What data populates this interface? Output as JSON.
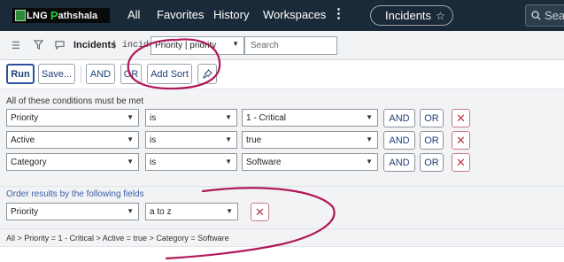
{
  "logo": {
    "lng": "LNG",
    "p": "P",
    "rest": "athshala"
  },
  "topnav": {
    "links": [
      "All",
      "Favorites",
      "History",
      "Workspaces"
    ],
    "current_tab": "Incidents",
    "search_placeholder": "Sear"
  },
  "listbar": {
    "title": "Incidents",
    "table_name": "incident",
    "field_select": "Priority | priority",
    "search_placeholder": "Search"
  },
  "buttons": {
    "run": "Run",
    "save": "Save...",
    "and": "AND",
    "or": "OR",
    "add_sort": "Add Sort"
  },
  "conditions": {
    "heading": "All of these conditions must be met",
    "rows": [
      {
        "field": "Priority",
        "operator": "is",
        "value": "1 - Critical"
      },
      {
        "field": "Active",
        "operator": "is",
        "value": "true"
      },
      {
        "field": "Category",
        "operator": "is",
        "value": "Software"
      }
    ],
    "and_label": "AND",
    "or_label": "OR"
  },
  "order": {
    "heading": "Order results by the following fields",
    "field": "Priority",
    "direction": "a to z"
  },
  "breadcrumb": "All > Priority = 1 - Critical > Active = true > Category = Software",
  "colors": {
    "nav_bg": "#1b2a38",
    "accent": "#1f3f78",
    "annotation": "#b0185a",
    "remove": "#b43a48"
  }
}
